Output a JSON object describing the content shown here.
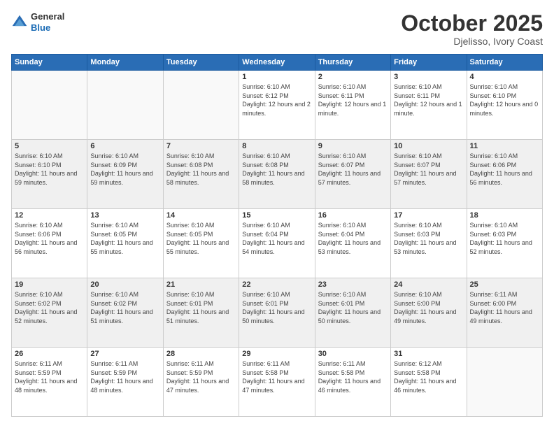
{
  "header": {
    "logo_general": "General",
    "logo_blue": "Blue",
    "month": "October 2025",
    "location": "Djelisso, Ivory Coast"
  },
  "weekdays": [
    "Sunday",
    "Monday",
    "Tuesday",
    "Wednesday",
    "Thursday",
    "Friday",
    "Saturday"
  ],
  "weeks": [
    [
      {
        "day": "",
        "sunrise": "",
        "sunset": "",
        "daylight": ""
      },
      {
        "day": "",
        "sunrise": "",
        "sunset": "",
        "daylight": ""
      },
      {
        "day": "",
        "sunrise": "",
        "sunset": "",
        "daylight": ""
      },
      {
        "day": "1",
        "sunrise": "Sunrise: 6:10 AM",
        "sunset": "Sunset: 6:12 PM",
        "daylight": "Daylight: 12 hours and 2 minutes."
      },
      {
        "day": "2",
        "sunrise": "Sunrise: 6:10 AM",
        "sunset": "Sunset: 6:11 PM",
        "daylight": "Daylight: 12 hours and 1 minute."
      },
      {
        "day": "3",
        "sunrise": "Sunrise: 6:10 AM",
        "sunset": "Sunset: 6:11 PM",
        "daylight": "Daylight: 12 hours and 1 minute."
      },
      {
        "day": "4",
        "sunrise": "Sunrise: 6:10 AM",
        "sunset": "Sunset: 6:10 PM",
        "daylight": "Daylight: 12 hours and 0 minutes."
      }
    ],
    [
      {
        "day": "5",
        "sunrise": "Sunrise: 6:10 AM",
        "sunset": "Sunset: 6:10 PM",
        "daylight": "Daylight: 11 hours and 59 minutes."
      },
      {
        "day": "6",
        "sunrise": "Sunrise: 6:10 AM",
        "sunset": "Sunset: 6:09 PM",
        "daylight": "Daylight: 11 hours and 59 minutes."
      },
      {
        "day": "7",
        "sunrise": "Sunrise: 6:10 AM",
        "sunset": "Sunset: 6:08 PM",
        "daylight": "Daylight: 11 hours and 58 minutes."
      },
      {
        "day": "8",
        "sunrise": "Sunrise: 6:10 AM",
        "sunset": "Sunset: 6:08 PM",
        "daylight": "Daylight: 11 hours and 58 minutes."
      },
      {
        "day": "9",
        "sunrise": "Sunrise: 6:10 AM",
        "sunset": "Sunset: 6:07 PM",
        "daylight": "Daylight: 11 hours and 57 minutes."
      },
      {
        "day": "10",
        "sunrise": "Sunrise: 6:10 AM",
        "sunset": "Sunset: 6:07 PM",
        "daylight": "Daylight: 11 hours and 57 minutes."
      },
      {
        "day": "11",
        "sunrise": "Sunrise: 6:10 AM",
        "sunset": "Sunset: 6:06 PM",
        "daylight": "Daylight: 11 hours and 56 minutes."
      }
    ],
    [
      {
        "day": "12",
        "sunrise": "Sunrise: 6:10 AM",
        "sunset": "Sunset: 6:06 PM",
        "daylight": "Daylight: 11 hours and 56 minutes."
      },
      {
        "day": "13",
        "sunrise": "Sunrise: 6:10 AM",
        "sunset": "Sunset: 6:05 PM",
        "daylight": "Daylight: 11 hours and 55 minutes."
      },
      {
        "day": "14",
        "sunrise": "Sunrise: 6:10 AM",
        "sunset": "Sunset: 6:05 PM",
        "daylight": "Daylight: 11 hours and 55 minutes."
      },
      {
        "day": "15",
        "sunrise": "Sunrise: 6:10 AM",
        "sunset": "Sunset: 6:04 PM",
        "daylight": "Daylight: 11 hours and 54 minutes."
      },
      {
        "day": "16",
        "sunrise": "Sunrise: 6:10 AM",
        "sunset": "Sunset: 6:04 PM",
        "daylight": "Daylight: 11 hours and 53 minutes."
      },
      {
        "day": "17",
        "sunrise": "Sunrise: 6:10 AM",
        "sunset": "Sunset: 6:03 PM",
        "daylight": "Daylight: 11 hours and 53 minutes."
      },
      {
        "day": "18",
        "sunrise": "Sunrise: 6:10 AM",
        "sunset": "Sunset: 6:03 PM",
        "daylight": "Daylight: 11 hours and 52 minutes."
      }
    ],
    [
      {
        "day": "19",
        "sunrise": "Sunrise: 6:10 AM",
        "sunset": "Sunset: 6:02 PM",
        "daylight": "Daylight: 11 hours and 52 minutes."
      },
      {
        "day": "20",
        "sunrise": "Sunrise: 6:10 AM",
        "sunset": "Sunset: 6:02 PM",
        "daylight": "Daylight: 11 hours and 51 minutes."
      },
      {
        "day": "21",
        "sunrise": "Sunrise: 6:10 AM",
        "sunset": "Sunset: 6:01 PM",
        "daylight": "Daylight: 11 hours and 51 minutes."
      },
      {
        "day": "22",
        "sunrise": "Sunrise: 6:10 AM",
        "sunset": "Sunset: 6:01 PM",
        "daylight": "Daylight: 11 hours and 50 minutes."
      },
      {
        "day": "23",
        "sunrise": "Sunrise: 6:10 AM",
        "sunset": "Sunset: 6:01 PM",
        "daylight": "Daylight: 11 hours and 50 minutes."
      },
      {
        "day": "24",
        "sunrise": "Sunrise: 6:10 AM",
        "sunset": "Sunset: 6:00 PM",
        "daylight": "Daylight: 11 hours and 49 minutes."
      },
      {
        "day": "25",
        "sunrise": "Sunrise: 6:11 AM",
        "sunset": "Sunset: 6:00 PM",
        "daylight": "Daylight: 11 hours and 49 minutes."
      }
    ],
    [
      {
        "day": "26",
        "sunrise": "Sunrise: 6:11 AM",
        "sunset": "Sunset: 5:59 PM",
        "daylight": "Daylight: 11 hours and 48 minutes."
      },
      {
        "day": "27",
        "sunrise": "Sunrise: 6:11 AM",
        "sunset": "Sunset: 5:59 PM",
        "daylight": "Daylight: 11 hours and 48 minutes."
      },
      {
        "day": "28",
        "sunrise": "Sunrise: 6:11 AM",
        "sunset": "Sunset: 5:59 PM",
        "daylight": "Daylight: 11 hours and 47 minutes."
      },
      {
        "day": "29",
        "sunrise": "Sunrise: 6:11 AM",
        "sunset": "Sunset: 5:58 PM",
        "daylight": "Daylight: 11 hours and 47 minutes."
      },
      {
        "day": "30",
        "sunrise": "Sunrise: 6:11 AM",
        "sunset": "Sunset: 5:58 PM",
        "daylight": "Daylight: 11 hours and 46 minutes."
      },
      {
        "day": "31",
        "sunrise": "Sunrise: 6:12 AM",
        "sunset": "Sunset: 5:58 PM",
        "daylight": "Daylight: 11 hours and 46 minutes."
      },
      {
        "day": "",
        "sunrise": "",
        "sunset": "",
        "daylight": ""
      }
    ]
  ]
}
